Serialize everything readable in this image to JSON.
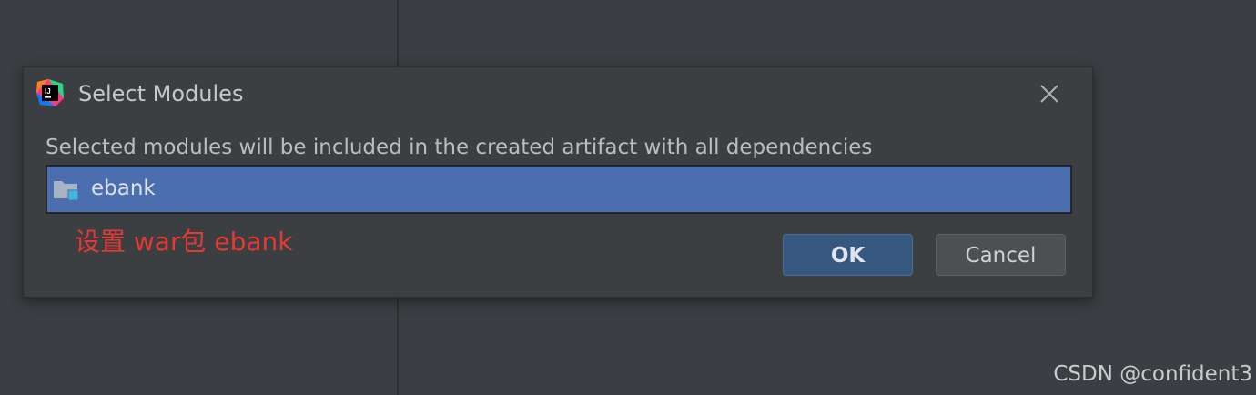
{
  "dialog": {
    "title": "Select Modules",
    "description": "Selected modules will be included in the created artifact with all dependencies",
    "modules": [
      {
        "name": "ebank",
        "selected": true,
        "icon": "folder-module-icon"
      }
    ],
    "ok_label": "OK",
    "cancel_label": "Cancel",
    "app_icon": "intellij-idea-icon",
    "close_icon": "close-icon"
  },
  "annotation": {
    "text": "设置 war包  ebank",
    "color": "#e53935"
  },
  "watermark": {
    "text": "CSDN @confident3"
  },
  "colors": {
    "background": "#3b3e42",
    "dialog": "#3c3f41",
    "selection": "#4b6eaf",
    "ok_button": "#365880",
    "cancel_button": "#4c5052"
  }
}
